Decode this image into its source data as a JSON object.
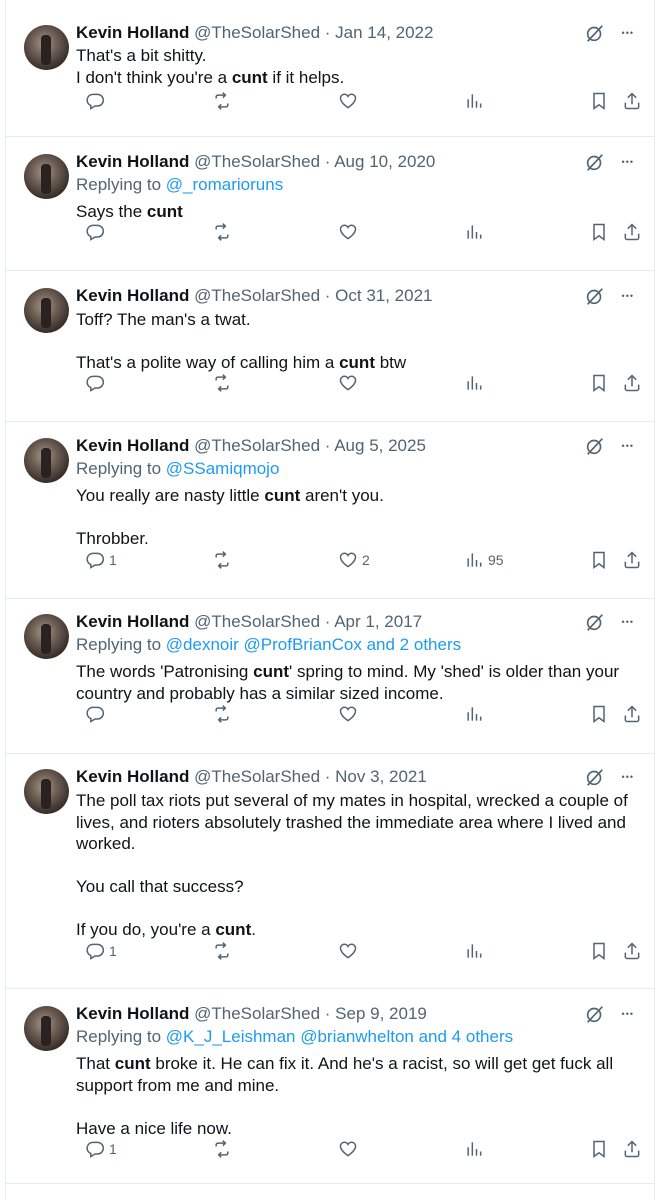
{
  "tweets": [
    {
      "name": "Kevin Holland",
      "handle": "@TheSolarShed",
      "date": "Jan 14, 2022",
      "replying_prefix": "",
      "replying_to": "",
      "lines": [
        [
          "That's a bit shitty.",
          "",
          ""
        ],
        [
          "I don't think you're a ",
          "cunt",
          " if it helps."
        ]
      ],
      "stats": {
        "replies": "",
        "likes": "",
        "views": ""
      }
    },
    {
      "name": "Kevin Holland",
      "handle": "@TheSolarShed",
      "date": "Aug 10, 2020",
      "replying_prefix": "Replying to ",
      "replying_to": "@_romarioruns",
      "lines": [
        [
          "Says the ",
          "cunt",
          ""
        ]
      ],
      "stats": {
        "replies": "",
        "likes": "",
        "views": ""
      }
    },
    {
      "name": "Kevin Holland",
      "handle": "@TheSolarShed",
      "date": "Oct 31, 2021",
      "replying_prefix": "",
      "replying_to": "",
      "lines": [
        [
          "Toff?  The man's a twat.",
          "",
          ""
        ],
        [
          "",
          "",
          ""
        ],
        [
          "That's a polite way of calling him a ",
          "cunt",
          " btw"
        ]
      ],
      "stats": {
        "replies": "",
        "likes": "",
        "views": ""
      }
    },
    {
      "name": "Kevin Holland",
      "handle": "@TheSolarShed",
      "date": "Aug 5, 2025",
      "replying_prefix": "Replying to ",
      "replying_to": "@SSamiqmojo",
      "lines": [
        [
          "You really are nasty little ",
          "cunt",
          " aren't you."
        ],
        [
          "",
          "",
          ""
        ],
        [
          "Throbber.",
          "",
          ""
        ]
      ],
      "stats": {
        "replies": "1",
        "likes": "2",
        "views": "95"
      }
    },
    {
      "name": "Kevin Holland",
      "handle": "@TheSolarShed",
      "date": "Apr 1, 2017",
      "replying_prefix": "Replying to ",
      "replying_to": "@dexnoir @ProfBrianCox and 2 others",
      "lines": [
        [
          "The words 'Patronising ",
          "cunt",
          "' spring to mind.  My 'shed' is older than your"
        ],
        [
          "country and probably has a similar sized income.",
          "",
          ""
        ]
      ],
      "stats": {
        "replies": "",
        "likes": "",
        "views": ""
      }
    },
    {
      "name": "Kevin Holland",
      "handle": "@TheSolarShed",
      "date": "Nov 3, 2021",
      "replying_prefix": "",
      "replying_to": "",
      "lines": [
        [
          "The poll tax riots put several of my mates in hospital, wrecked a couple of",
          "",
          ""
        ],
        [
          "lives,  and rioters absolutely trashed the immediate area where I lived and",
          "",
          ""
        ],
        [
          "worked.",
          "",
          ""
        ],
        [
          "",
          "",
          ""
        ],
        [
          "You call that success?",
          "",
          ""
        ],
        [
          "",
          "",
          ""
        ],
        [
          "If you do, you're a ",
          "cunt",
          "."
        ]
      ],
      "stats": {
        "replies": "1",
        "likes": "",
        "views": ""
      }
    },
    {
      "name": "Kevin Holland",
      "handle": "@TheSolarShed",
      "date": "Sep 9, 2019",
      "replying_prefix": "Replying to ",
      "replying_to": "@K_J_Leishman @brianwhelton and 4 others",
      "lines": [
        [
          "That ",
          "cunt",
          " broke it.  He can fix it.  And he's a racist, so will get get fuck all"
        ],
        [
          "support from me and mine.",
          "",
          ""
        ],
        [
          "",
          "",
          ""
        ],
        [
          "Have a nice life now.",
          "",
          ""
        ]
      ],
      "stats": {
        "replies": "1",
        "likes": "",
        "views": ""
      }
    }
  ],
  "icons": {
    "reply": "reply-icon",
    "retweet": "retweet-icon",
    "like": "like-icon",
    "views": "views-icon",
    "bookmark": "bookmark-icon",
    "share": "share-icon",
    "grok": "grok-icon",
    "more": "more-icon"
  },
  "colors": {
    "text": "#0f1419",
    "muted": "#536471",
    "link": "#1d9bf0",
    "border": "#e6ecf0"
  }
}
